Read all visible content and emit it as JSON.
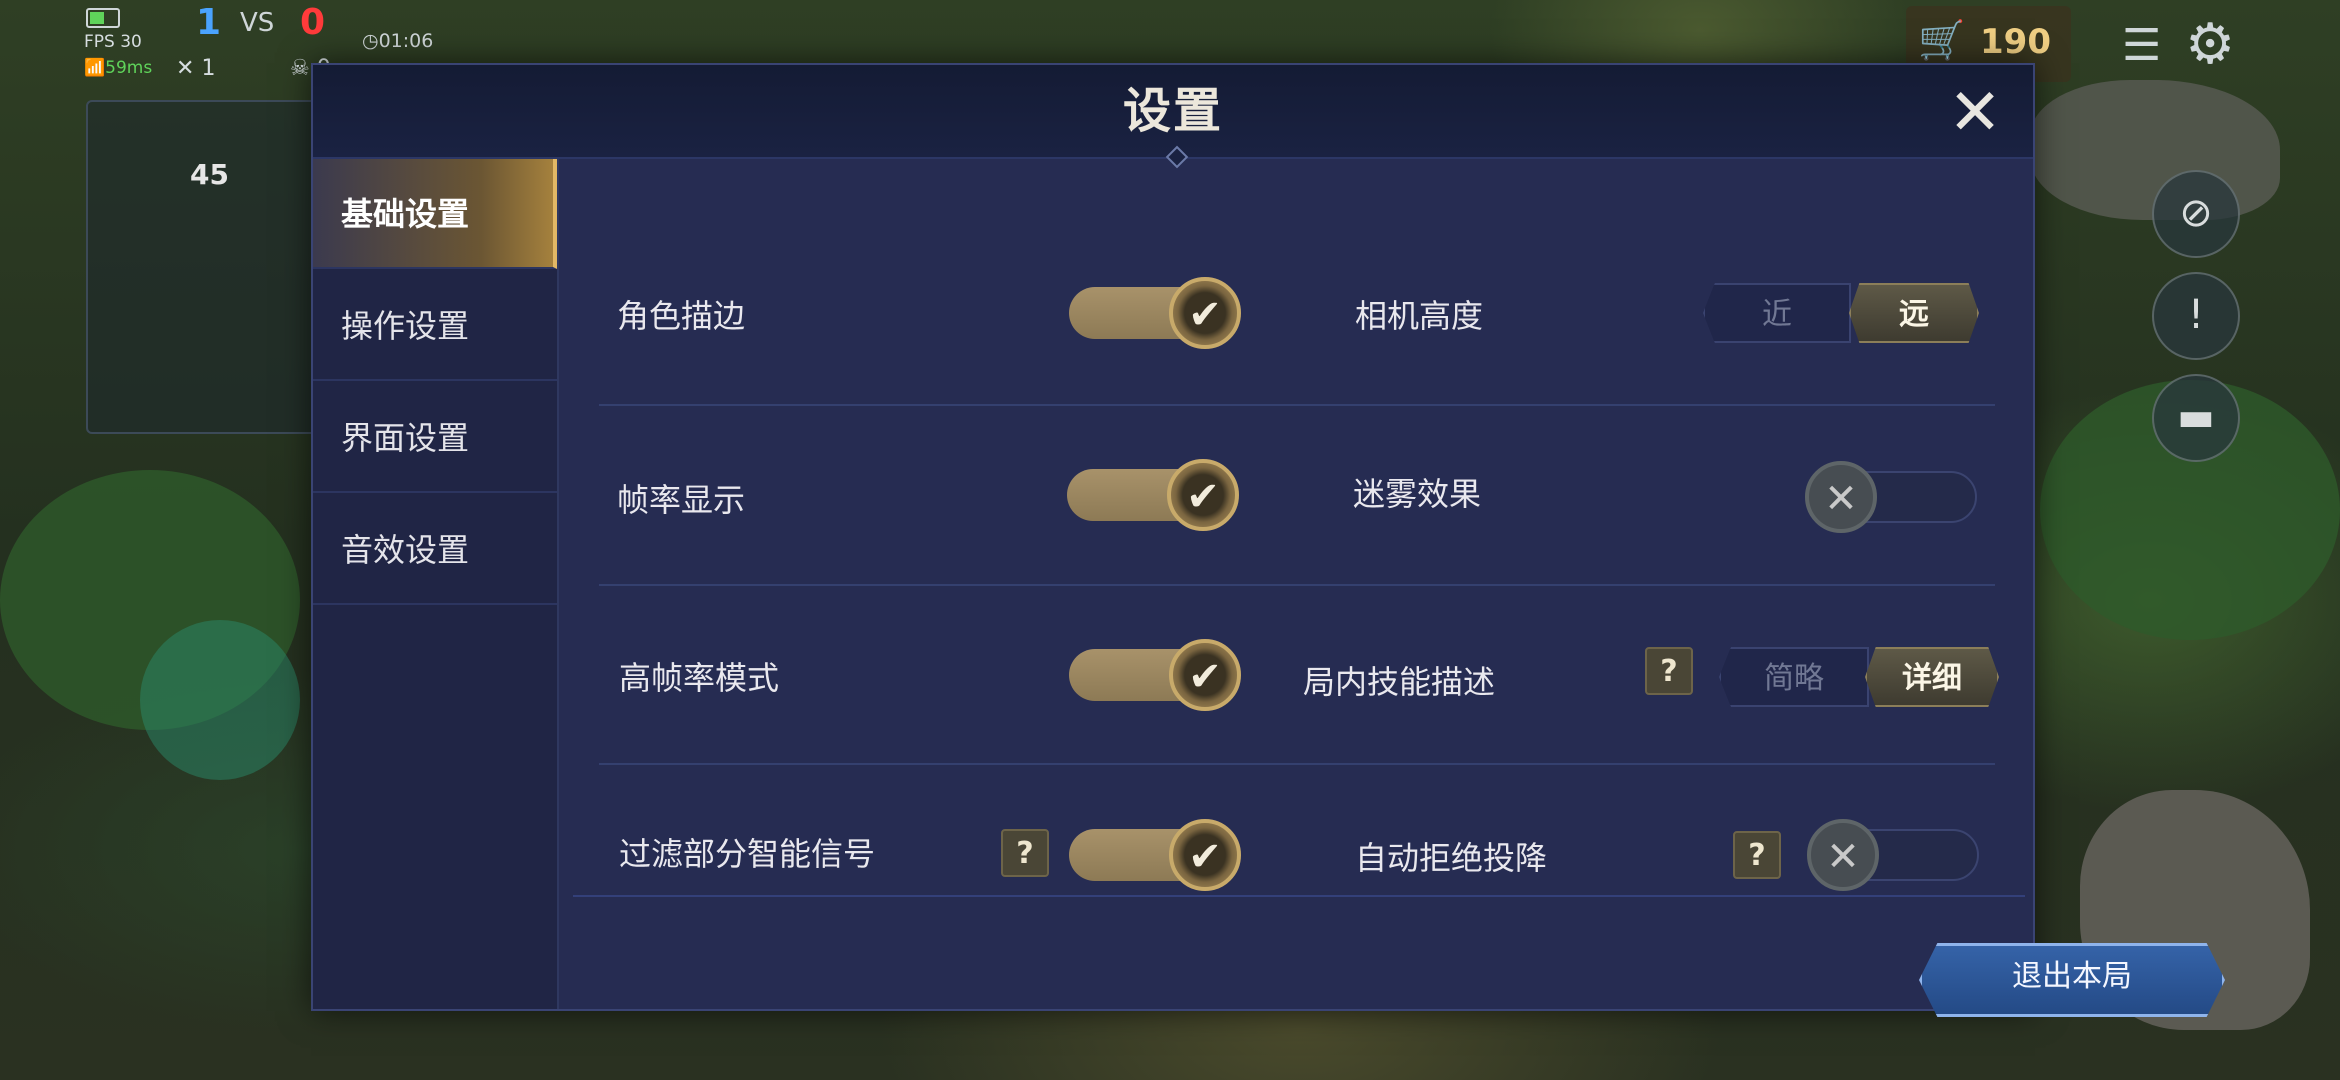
{
  "hud": {
    "fps": "FPS 30",
    "ping": "59ms",
    "blue_score": "1",
    "vs": "VS",
    "red_score": "0",
    "time": "01:06",
    "kills": "1",
    "deaths": "0",
    "minimap_number": "45",
    "gold": "190"
  },
  "panel": {
    "title": "设置",
    "tabs": [
      {
        "label": "基础设置",
        "active": true
      },
      {
        "label": "操作设置",
        "active": false
      },
      {
        "label": "界面设置",
        "active": false
      },
      {
        "label": "音效设置",
        "active": false
      }
    ],
    "left_settings": [
      {
        "label": "角色描边",
        "on": true,
        "help": false
      },
      {
        "label": "帧率显示",
        "on": true,
        "help": false
      },
      {
        "label": "高帧率模式",
        "on": true,
        "help": false
      },
      {
        "label": "过滤部分智能信号",
        "on": true,
        "help": true
      }
    ],
    "right_settings": {
      "camera_height": {
        "label": "相机高度",
        "options": [
          "近",
          "远"
        ],
        "selected": "远"
      },
      "fog_effect": {
        "label": "迷雾效果",
        "on": false
      },
      "skill_desc": {
        "label": "局内技能描述",
        "options": [
          "简略",
          "详细"
        ],
        "selected": "详细",
        "help": true
      },
      "auto_reject_surrender": {
        "label": "自动拒绝投降",
        "on": false,
        "help": true
      }
    },
    "help_mark": "?",
    "check_mark": "✔",
    "cross_mark": "✕",
    "close_mark": "✕",
    "exit_label": "退出本局"
  },
  "icons": {
    "shop": "cart-icon",
    "menu": "menu-icon",
    "settings": "gear-icon"
  },
  "colors": {
    "panel_bg": "#262c52",
    "accent_gold": "#c8aa6a",
    "exit_blue": "#2e5a9c"
  }
}
